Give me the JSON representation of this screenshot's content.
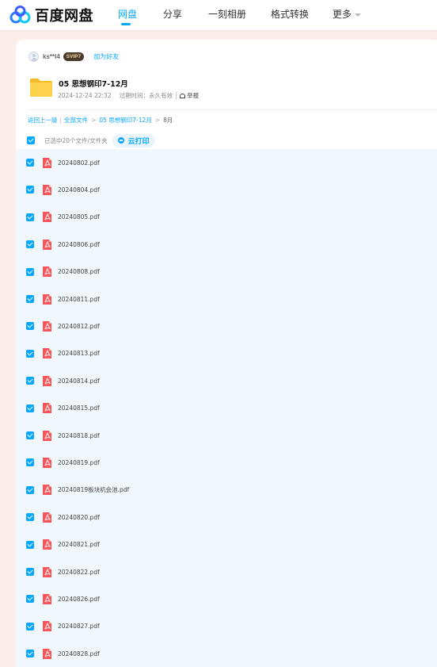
{
  "header": {
    "logo_text": "百度网盘",
    "nav": [
      {
        "label": "网盘",
        "active": true
      },
      {
        "label": "分享",
        "active": false
      },
      {
        "label": "一刻相册",
        "active": false
      },
      {
        "label": "格式转换",
        "active": false
      },
      {
        "label": "更多",
        "active": false
      }
    ]
  },
  "share": {
    "username": "ks**l4",
    "vip_badge": "SVIP7",
    "add_friend": "加为好友",
    "title": "05 思想钢印7-12月",
    "date": "2024-12-24 22:32",
    "expire": "过期时间：永久有效",
    "report": "举报"
  },
  "breadcrumb": {
    "back": "返回上一级",
    "all": "全部文件",
    "folder": "05 思想钢印7-12月",
    "current": "8月"
  },
  "selection": {
    "text": "已选中20个文件/文件夹",
    "print_button": "云打印"
  },
  "files": [
    {
      "name": "20240802.pdf",
      "checked": true
    },
    {
      "name": "20240804.pdf",
      "checked": true
    },
    {
      "name": "20240805.pdf",
      "checked": true
    },
    {
      "name": "20240806.pdf",
      "checked": true
    },
    {
      "name": "20240808.pdf",
      "checked": true
    },
    {
      "name": "20240811.pdf",
      "checked": true
    },
    {
      "name": "20240812.pdf",
      "checked": true
    },
    {
      "name": "20240813.pdf",
      "checked": true
    },
    {
      "name": "20240814.pdf",
      "checked": true
    },
    {
      "name": "20240815.pdf",
      "checked": true
    },
    {
      "name": "20240818.pdf",
      "checked": true
    },
    {
      "name": "20240819.pdf",
      "checked": true
    },
    {
      "name": "20240819板块机会池.pdf",
      "checked": true
    },
    {
      "name": "20240820.pdf",
      "checked": true
    },
    {
      "name": "20240821.pdf",
      "checked": true
    },
    {
      "name": "20240822.pdf",
      "checked": true
    },
    {
      "name": "20240826.pdf",
      "checked": true
    },
    {
      "name": "20240827.pdf",
      "checked": true
    },
    {
      "name": "20240828.pdf",
      "checked": true
    }
  ],
  "colors": {
    "accent": "#06a7ff",
    "pdf_red": "#f5565a",
    "folder_yellow": "#ffc93c"
  }
}
